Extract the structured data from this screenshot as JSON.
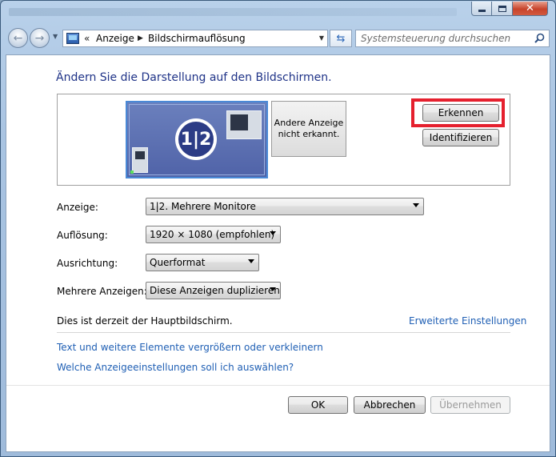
{
  "window": {
    "controls": {
      "minimize": "minimize-icon",
      "maximize": "maximize-icon",
      "close": "close-icon"
    }
  },
  "nav": {
    "back_icon": "arrow-left-icon",
    "forward_icon": "arrow-right-icon",
    "breadcrumb_prefix": "«",
    "breadcrumbs": [
      "Anzeige",
      "Bildschirmauflösung"
    ],
    "search_placeholder": "Systemsteuerung durchsuchen"
  },
  "main": {
    "heading": "Ändern Sie die Darstellung auf den Bildschirmen.",
    "monitors": {
      "primary_label": "1|2",
      "secondary_text_line1": "Andere Anzeige",
      "secondary_text_line2": "nicht erkannt."
    },
    "buttons": {
      "detect": "Erkennen",
      "identify": "Identifizieren"
    },
    "settings": [
      {
        "label": "Anzeige:",
        "value": "1|2. Mehrere Monitore"
      },
      {
        "label": "Auflösung:",
        "value": "1920 × 1080 (empfohlen)"
      },
      {
        "label": "Ausrichtung:",
        "value": "Querformat"
      },
      {
        "label": "Mehrere Anzeigen:",
        "value": "Diese Anzeigen duplizieren"
      }
    ],
    "primary_note": "Dies ist derzeit der Hauptbildschirm.",
    "advanced_link": "Erweiterte Einstellungen",
    "links": [
      "Text und weitere Elemente vergrößern oder verkleinern",
      "Welche Anzeigeeinstellungen soll ich auswählen?"
    ]
  },
  "footer": {
    "ok": "OK",
    "cancel": "Abbrechen",
    "apply": "Übernehmen"
  },
  "colors": {
    "heading": "#1e3287",
    "link": "#1f5fb4",
    "highlight": "#e5202e"
  }
}
